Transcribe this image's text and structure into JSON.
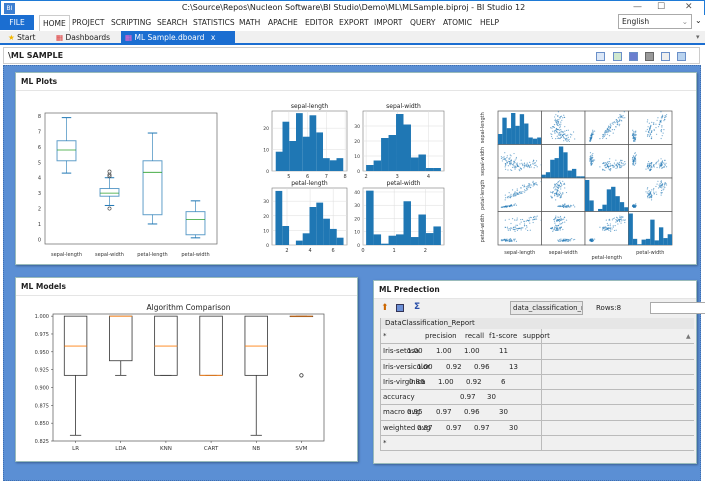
{
  "window": {
    "title": "C:\\Source\\Repos\\Nucleon Software\\BI Studio\\Demo\\ML\\MLSample.biproj - BI Studio 12",
    "app_icon": "BI",
    "controls": [
      "—",
      "☐",
      "✕"
    ]
  },
  "menu": {
    "file": "FILE",
    "items": [
      "HOME",
      "PROJECT",
      "SCRIPTING",
      "SEARCH",
      "STATISTICS",
      "MATH",
      "APACHE",
      "EDITOR",
      "EXPORT",
      "IMPORT",
      "QUERY",
      "ATOMIC",
      "HELP"
    ],
    "language": "English"
  },
  "tabs": [
    {
      "label": "Start",
      "icon": "star-icon"
    },
    {
      "label": "Dashboards",
      "icon": "dashboard-icon"
    },
    {
      "label": "ML Sample.dboard",
      "icon": "dashboard-icon",
      "active": true,
      "close": "x"
    }
  ],
  "dashboard": {
    "title": "\\ML SAMPLE",
    "toolbar_icons": [
      "edit-icon",
      "refresh-icon",
      "save-icon",
      "print-icon",
      "print-preview-icon",
      "settings-icon"
    ]
  },
  "panels": {
    "plots": "ML Plots",
    "models": "ML Models",
    "prediction": "ML Predection"
  },
  "colors": {
    "accent": "#1b6ed1",
    "background": "#5b8fd4",
    "box_blue": "#1f77b4",
    "median_green": "#2ca02c",
    "median_orange": "#ff7f0e"
  },
  "chart_data": [
    {
      "type": "boxplot",
      "categories": [
        "sepal-length",
        "sepal-width",
        "petal-length",
        "petal-width"
      ],
      "ylim": [
        -0.3,
        8.2
      ],
      "yticks": [
        0,
        1,
        2,
        3,
        4,
        5,
        6,
        7,
        8
      ],
      "boxes": [
        {
          "min": 4.3,
          "q1": 5.1,
          "median": 5.8,
          "q3": 6.4,
          "max": 7.9,
          "outliers": []
        },
        {
          "min": 2.2,
          "q1": 2.8,
          "median": 3.0,
          "q3": 3.3,
          "max": 4.0,
          "outliers": [
            4.4,
            4.1,
            4.2,
            2.0
          ]
        },
        {
          "min": 1.0,
          "q1": 1.6,
          "median": 4.35,
          "q3": 5.1,
          "max": 6.9,
          "outliers": []
        },
        {
          "min": 0.1,
          "q1": 0.3,
          "median": 1.3,
          "q3": 1.8,
          "max": 2.5,
          "outliers": []
        }
      ]
    },
    {
      "type": "histogram",
      "subplots": [
        {
          "title": "sepal-length",
          "range": [
            4.3,
            7.9
          ],
          "counts": [
            9,
            23,
            14,
            27,
            16,
            26,
            18,
            6,
            5,
            6
          ],
          "xticks": [
            5,
            6,
            7,
            8
          ],
          "xlim": [
            4.1,
            8.1
          ],
          "yticks": [
            0,
            10,
            20
          ],
          "ymax": 28
        },
        {
          "title": "sepal-width",
          "range": [
            2.0,
            4.4
          ],
          "counts": [
            4,
            7,
            22,
            24,
            38,
            31,
            9,
            11,
            2,
            2
          ],
          "xticks": [
            2,
            3,
            4
          ],
          "xlim": [
            1.9,
            4.5
          ],
          "yticks": [
            0,
            10,
            20,
            30
          ],
          "ymax": 40
        },
        {
          "title": "petal-length",
          "range": [
            1.0,
            6.9
          ],
          "counts": [
            37,
            13,
            0,
            3,
            8,
            26,
            29,
            18,
            11,
            5
          ],
          "xticks": [
            2,
            4,
            6
          ],
          "xlim": [
            0.7,
            7.2
          ],
          "yticks": [
            0,
            10,
            20,
            30
          ],
          "ymax": 39
        },
        {
          "title": "petal-width",
          "range": [
            0.1,
            2.5
          ],
          "counts": [
            41,
            8,
            1,
            7,
            8,
            33,
            6,
            23,
            9,
            14
          ],
          "xticks": [
            0,
            1,
            2
          ],
          "xlim": [
            0,
            2.6
          ],
          "yticks": [
            0,
            10,
            20,
            30,
            40
          ],
          "ymax": 43
        }
      ]
    },
    {
      "type": "scatter_matrix",
      "variables": [
        "sepal-length",
        "sepal-width",
        "petal-length",
        "petal-width"
      ],
      "ticks": {
        "sepal-length": [
          5,
          6,
          7
        ],
        "sepal-width": [
          2,
          3,
          4
        ],
        "petal-length": [
          2.5,
          5.0
        ],
        "petal-width": [
          1,
          2
        ]
      }
    },
    {
      "type": "boxplot",
      "title": "Algorithm Comparison",
      "categories": [
        "LR",
        "LDA",
        "KNN",
        "CART",
        "NB",
        "SVM"
      ],
      "ylim": [
        0.825,
        1.003
      ],
      "yticks": [
        "0.825",
        "0.850",
        "0.875",
        "0.900",
        "0.925",
        "0.950",
        "0.975",
        "1.000"
      ],
      "boxes": [
        {
          "min": 0.833,
          "q1": 0.917,
          "median": 0.958,
          "q3": 1.0,
          "max": 1.0,
          "outliers": []
        },
        {
          "min": 0.917,
          "q1": 0.9375,
          "median": 1.0,
          "q3": 1.0,
          "max": 1.0,
          "outliers": []
        },
        {
          "min": 0.917,
          "q1": 0.917,
          "median": 0.958,
          "q3": 1.0,
          "max": 1.0,
          "outliers": []
        },
        {
          "min": 0.917,
          "q1": 0.917,
          "median": 0.917,
          "q3": 1.0,
          "max": 1.0,
          "outliers": []
        },
        {
          "min": 0.833,
          "q1": 0.917,
          "median": 0.958,
          "q3": 1.0,
          "max": 1.0,
          "outliers": []
        },
        {
          "min": 1.0,
          "q1": 1.0,
          "median": 1.0,
          "q3": 1.0,
          "max": 1.0,
          "outliers": [
            0.917
          ]
        }
      ]
    }
  ],
  "prediction": {
    "toolbar_icons": [
      "import-icon",
      "table-icon",
      "sum-icon"
    ],
    "sum_glyph": "Σ",
    "dataset": "data_classification_r",
    "rows_label": "Rows:8",
    "filter": "",
    "table_title": "DataClassification_Report",
    "header": [
      "*",
      "precision",
      "recall",
      "f1-score",
      "support"
    ],
    "rows": [
      [
        "Iris-setosa",
        "1.00",
        "1.00",
        "1.00",
        "11"
      ],
      [
        "Iris-versicolor",
        "1.00",
        "0.92",
        "0.96",
        "13"
      ],
      [
        "Iris-virginica",
        "0.86",
        "1.00",
        "0.92",
        "6"
      ],
      [
        "accuracy",
        "",
        "0.97",
        "30",
        ""
      ],
      [
        "macro avg",
        "0.95",
        "0.97",
        "0.96",
        "30"
      ],
      [
        "weighted avg",
        "0.97",
        "0.97",
        "0.97",
        "30"
      ],
      [
        "*",
        "",
        "",
        "",
        ""
      ]
    ]
  }
}
